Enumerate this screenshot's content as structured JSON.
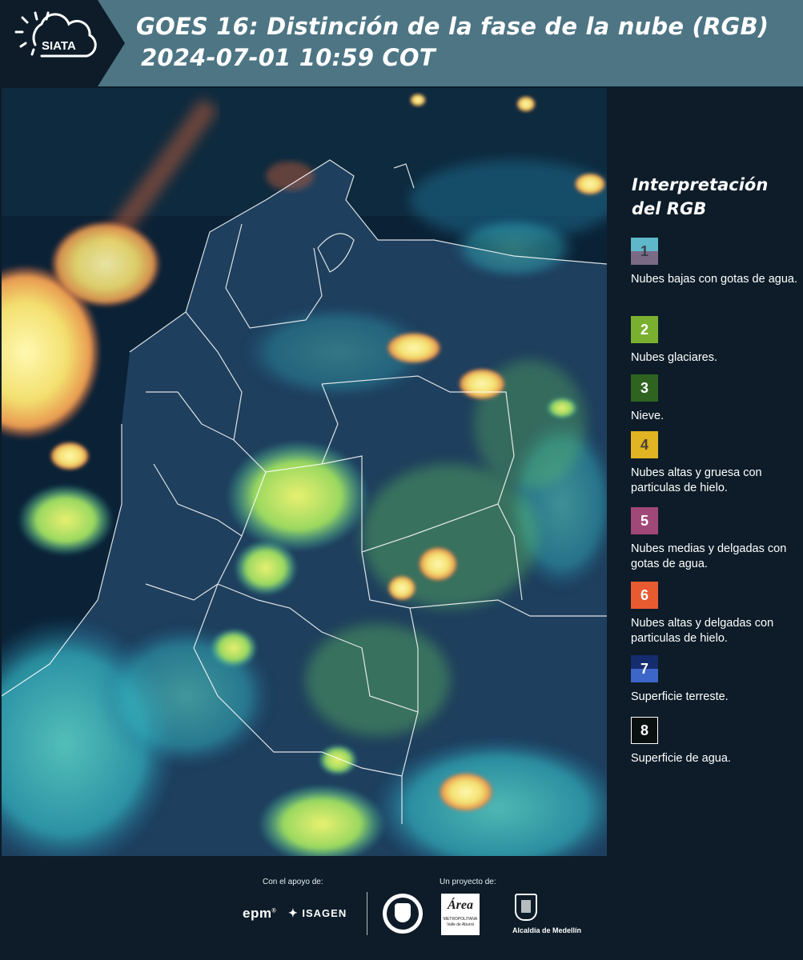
{
  "header": {
    "logo_text": "SIATA",
    "title_line1": "GOES 16: Distinción de la fase de la nube (RGB)",
    "title_line2": "2024-07-01 10:59 COT"
  },
  "legend": {
    "title_line1": "Interpretación",
    "title_line2": "del RGB",
    "items": [
      {
        "number": "1",
        "label": "Nubes bajas con gotas de agua.",
        "color_top": "#5fb8c9",
        "color_bottom": "#7a6a86",
        "number_color": "#3b3f4a"
      },
      {
        "number": "2",
        "label": "Nubes glaciares.",
        "color_top": "#7ab030",
        "color_bottom": "#7ab030",
        "number_color": "#ffffff"
      },
      {
        "number": "3",
        "label": "Nieve.",
        "color_top": "#2f6420",
        "color_bottom": "#2f6420",
        "number_color": "#ffffff"
      },
      {
        "number": "4",
        "label": "Nubes altas y gruesa con particulas de hielo.",
        "color_top": "#e0b422",
        "color_bottom": "#e0b422",
        "number_color": "#4a4030"
      },
      {
        "number": "5",
        "label": "Nubes medias y delgadas con gotas de agua.",
        "color_top": "#a04878",
        "color_bottom": "#a04878",
        "number_color": "#ffffff"
      },
      {
        "number": "6",
        "label": "Nubes altas y delgadas con particulas de hielo.",
        "color_top": "#e85a30",
        "color_bottom": "#e85a30",
        "number_color": "#ffffff"
      },
      {
        "number": "7",
        "label": "Superficie terreste.",
        "color_top": "#152c6e",
        "color_bottom": "#3c66c8",
        "number_color": "#ffffff"
      },
      {
        "number": "8",
        "label": "Superficie de agua.",
        "color_top": "#0a1010",
        "color_bottom": "#0a1010",
        "number_color": "#ffffff"
      }
    ]
  },
  "footer": {
    "support_caption": "Con el apoyo de:",
    "project_caption": "Un proyecto de:",
    "sponsor_epm": "epm",
    "sponsor_isagen": "ISAGEN",
    "area_logo_text": "Área",
    "area_logo_sub": "METROPOLITANA",
    "area_logo_sub2": "Valle de Aburrá",
    "alcaldia_text": "Alcaldía de Medellín"
  },
  "colors": {
    "header_bg": "#4d7584",
    "page_bg": "#0d1c28",
    "cloud_yellow": "#f2e06a",
    "cloud_cyan": "#3cc8c0",
    "land_blue": "#1a3668"
  }
}
